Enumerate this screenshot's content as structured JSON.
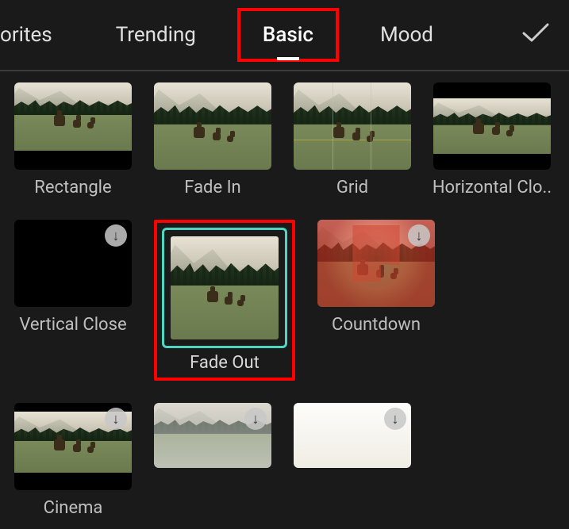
{
  "tabs": {
    "items": [
      {
        "label": "orites"
      },
      {
        "label": "Trending"
      },
      {
        "label": "Basic"
      },
      {
        "label": "Mood"
      }
    ],
    "active_index": 2
  },
  "confirm_icon": "check-icon",
  "download_icon": "↓",
  "effects": [
    {
      "label": "Rectangle",
      "style": "fx-rectangle",
      "download": false
    },
    {
      "label": "Fade In",
      "style": "fx-fadein",
      "download": false
    },
    {
      "label": "Grid",
      "style": "fx-grid",
      "download": false
    },
    {
      "label": "Horizontal Clo..",
      "style": "fx-hclose",
      "download": false
    },
    {
      "label": "Vertical Close",
      "style": "fx-vclose",
      "download": true
    },
    {
      "label": "Fade Out",
      "style": "fx-fadeout",
      "download": false,
      "selected": true
    },
    {
      "label": "Countdown",
      "style": "fx-count",
      "download": true
    },
    {
      "label": "Cinema",
      "style": "fx-cinema",
      "download": true
    },
    {
      "label": "",
      "style": "fx-faded",
      "download": true
    },
    {
      "label": "",
      "style": "fx-white",
      "download": true
    }
  ]
}
